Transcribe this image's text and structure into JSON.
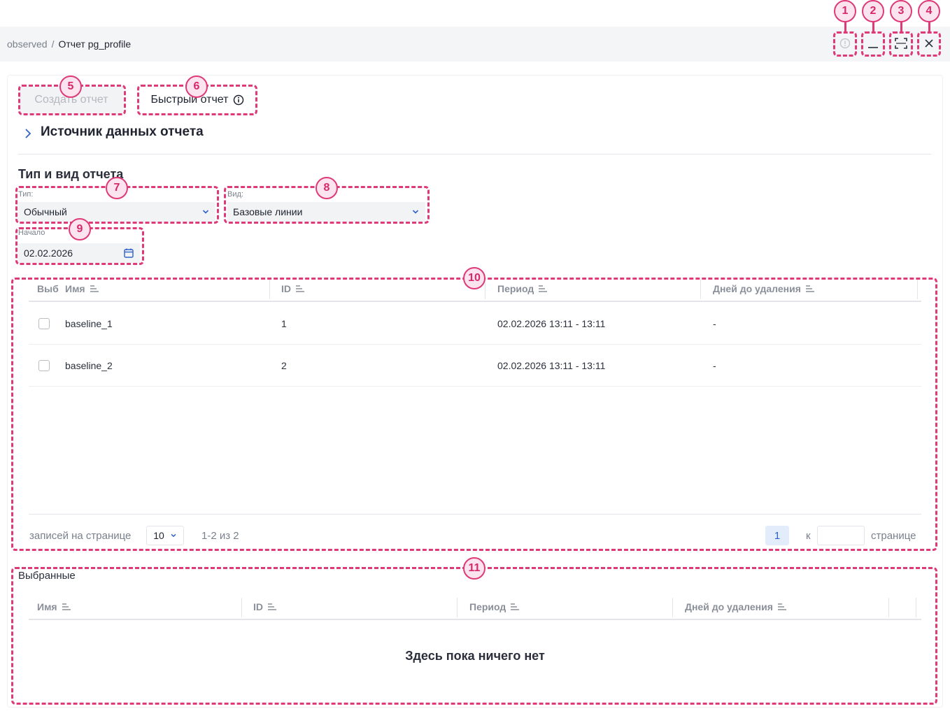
{
  "breadcrumb": {
    "root": "observed",
    "separator": "/",
    "current": "Отчет pg_profile"
  },
  "window_controls": [
    {
      "icon": "info-circle-icon"
    },
    {
      "icon": "minimize-icon"
    },
    {
      "icon": "expand-icon"
    },
    {
      "icon": "close-icon"
    }
  ],
  "actions": {
    "create_report": "Создать отчет",
    "quick_report": "Быстрый отчет",
    "quick_report_icon": "info-icon"
  },
  "data_source": {
    "title": "Источник данных отчета",
    "icon": "chevron-right-icon"
  },
  "report_type_section": {
    "title": "Тип и вид отчета",
    "type": {
      "label": "Тип:",
      "value": "Обычный"
    },
    "view": {
      "label": "Вид:",
      "value": "Базовые линии"
    },
    "start": {
      "label": "Начало",
      "value": "02.02.2026",
      "icon": "calendar-icon"
    }
  },
  "baselines_table": {
    "columns": {
      "select": "Выб",
      "name": "Имя",
      "id": "ID",
      "period": "Период",
      "days": "Дней до удаления"
    },
    "rows": [
      {
        "name": "baseline_1",
        "id": "1",
        "period": "02.02.2026 13:11 - 13:11",
        "days": "-"
      },
      {
        "name": "baseline_2",
        "id": "2",
        "period": "02.02.2026 13:11 - 13:11",
        "days": "-"
      }
    ],
    "pagination": {
      "per_page_label": "записей на странице",
      "per_page_value": "10",
      "range": "1-2 из 2",
      "current_page": "1",
      "goto_prefix": "к",
      "goto_suffix": "странице"
    }
  },
  "selected_table": {
    "title": "Выбранные",
    "columns": {
      "name": "Имя",
      "id": "ID",
      "period": "Период",
      "days": "Дней до удаления"
    },
    "empty_text": "Здесь пока ничего нет"
  },
  "annotations": [
    "1",
    "2",
    "3",
    "4",
    "5",
    "6",
    "7",
    "8",
    "9",
    "10",
    "11"
  ],
  "colors": {
    "annotation": "#de3a78",
    "accent": "#2f62c9",
    "background": "#f4f5f7"
  }
}
